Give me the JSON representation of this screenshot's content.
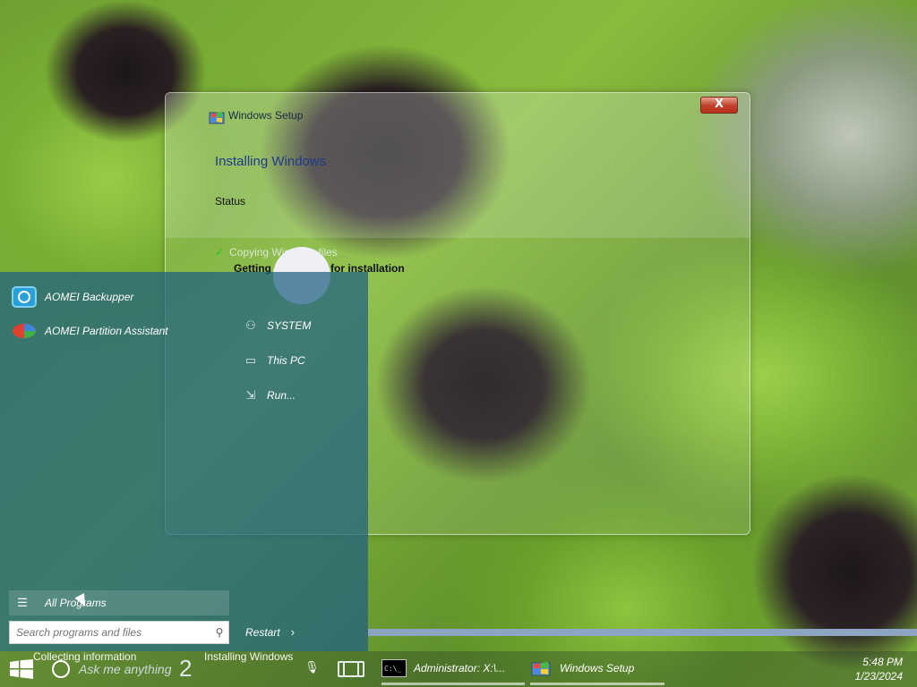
{
  "setup_window": {
    "title": "Windows Setup",
    "heading": "Installing Windows",
    "status_label": "Status",
    "step_done": "Copying Windows files",
    "step_current": "Getting files ready for installation",
    "close_label": "X",
    "accent_color": "#1f3a8a"
  },
  "start_menu": {
    "pinned": [
      {
        "label": "AOMEI Backupper",
        "icon": "aomei-backupper-icon"
      },
      {
        "label": "AOMEI Partition Assistant",
        "icon": "aomei-partition-icon"
      }
    ],
    "places": [
      {
        "label": "SYSTEM",
        "icon": "user-icon"
      },
      {
        "label": "This PC",
        "icon": "laptop-icon"
      },
      {
        "label": "Run...",
        "icon": "run-icon"
      }
    ],
    "all_programs": "All Programs",
    "search_placeholder": "Search programs and files",
    "restart_label": "Restart"
  },
  "taskbar": {
    "search_prompt": "Ask me anything",
    "overlay_collecting": "Collecting information",
    "overlay_step": "2",
    "overlay_installing": "Installing Windows",
    "apps": [
      {
        "label": "Administrator: X:\\...",
        "icon": "cmd-icon"
      },
      {
        "label": "Windows Setup",
        "icon": "windows-setup-icon"
      }
    ],
    "time": "5:48 PM",
    "date": "1/23/2024"
  }
}
